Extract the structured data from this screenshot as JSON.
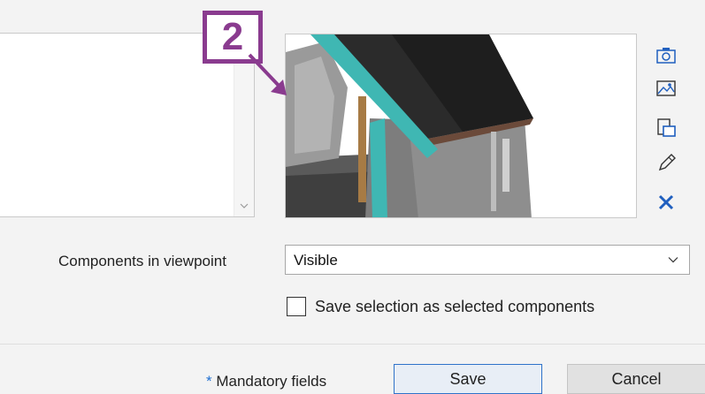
{
  "badge": {
    "number": "2",
    "color": "#8a3b8f"
  },
  "description": {
    "scroll_icon": "chevron-down-icon"
  },
  "viewpoint": {
    "image_alt": "3D building model viewpoint snapshot"
  },
  "side_icons": [
    {
      "name": "camera-icon",
      "interactable": true
    },
    {
      "name": "image-icon",
      "interactable": true
    },
    {
      "name": "paste-icon",
      "interactable": true
    },
    {
      "name": "pencil-icon",
      "interactable": true
    },
    {
      "name": "close-icon",
      "interactable": true,
      "color": "#1f5fbf"
    }
  ],
  "components": {
    "label": "Components in viewpoint",
    "selected": "Visible"
  },
  "save_selection": {
    "label": "Save selection as selected components",
    "checked": false
  },
  "footer": {
    "mandatory_star": "*",
    "mandatory_text": " Mandatory fields",
    "save_label": "Save",
    "cancel_label": "Cancel"
  }
}
